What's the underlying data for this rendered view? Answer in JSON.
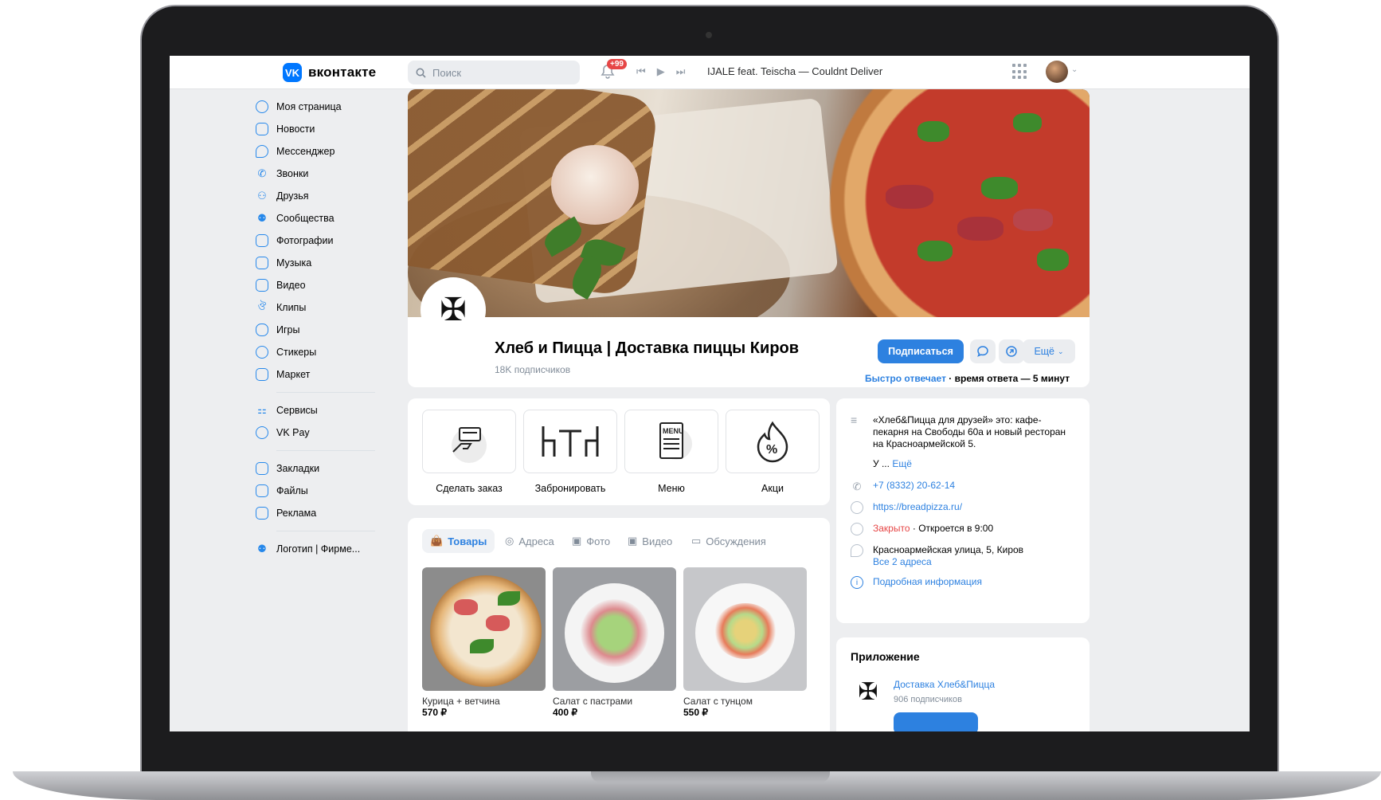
{
  "header": {
    "logo_text": "вконтакте",
    "logo_mark": "vk",
    "search_placeholder": "Поиск",
    "notifications_badge": "+99",
    "track": "IJALE feat. Teischa — Couldnt Deliver"
  },
  "sidebar": {
    "items": [
      {
        "label": "Моя страница",
        "icon": "user-circle-icon"
      },
      {
        "label": "Новости",
        "icon": "news-icon"
      },
      {
        "label": "Мессенджер",
        "icon": "message-icon"
      },
      {
        "label": "Звонки",
        "icon": "phone-icon"
      },
      {
        "label": "Друзья",
        "icon": "friends-icon"
      },
      {
        "label": "Сообщества",
        "icon": "communities-icon"
      },
      {
        "label": "Фотографии",
        "icon": "photo-icon"
      },
      {
        "label": "Музыка",
        "icon": "music-icon"
      },
      {
        "label": "Видео",
        "icon": "video-icon"
      },
      {
        "label": "Клипы",
        "icon": "clips-icon"
      },
      {
        "label": "Игры",
        "icon": "gamepad-icon"
      },
      {
        "label": "Стикеры",
        "icon": "smile-icon"
      },
      {
        "label": "Маркет",
        "icon": "bag-icon"
      }
    ],
    "items2": [
      {
        "label": "Сервисы",
        "icon": "services-icon"
      },
      {
        "label": "VK Pay",
        "icon": "vkpay-icon"
      }
    ],
    "items3": [
      {
        "label": "Закладки",
        "icon": "bookmark-icon"
      },
      {
        "label": "Файлы",
        "icon": "file-icon"
      },
      {
        "label": "Реклама",
        "icon": "megaphone-icon"
      }
    ],
    "items4": [
      {
        "label": "Логотип | Фирме...",
        "icon": "communities-icon"
      }
    ]
  },
  "group": {
    "title": "Хлеб и Пицца | Доставка пиццы Киров",
    "subscribers_count": "18K",
    "subscribers_label": "подписчиков",
    "subscribe_button": "Подписаться",
    "more_button": "Ещё",
    "reply_fast": "Быстро отвечает",
    "reply_time": "· время ответа — 5 минут"
  },
  "actions": [
    {
      "label": "Сделать заказ",
      "icon": "order-icon"
    },
    {
      "label": "Забронировать",
      "icon": "table-booking-icon"
    },
    {
      "label": "Меню",
      "icon": "menu-icon"
    },
    {
      "label": "Акци",
      "icon": "discount-icon"
    }
  ],
  "tabs": [
    {
      "label": "Товары",
      "icon": "bag-icon"
    },
    {
      "label": "Адреса",
      "icon": "pin-icon"
    },
    {
      "label": "Фото",
      "icon": "photo-icon"
    },
    {
      "label": "Видео",
      "icon": "video-icon"
    },
    {
      "label": "Обсуждения",
      "icon": "message-icon"
    }
  ],
  "products": [
    {
      "name": "Курица + ветчина",
      "price": "570 ₽"
    },
    {
      "name": "Салат с пастрами",
      "price": "400 ₽"
    },
    {
      "name": "Салат с тунцом",
      "price": "550 ₽"
    }
  ],
  "info": {
    "description": "«Хлеб&Пицца для друзей» это: кафе-пекарня на Свободы 60а и новый ресторан на Красноармейской 5.",
    "description_cont": "У ...",
    "description_more": "Ещё",
    "phone": "+7 (8332) 20-62-14",
    "site": "https://breadpizza.ru/",
    "status_closed": "Закрыто",
    "status_opens": "· Откроется в 9:00",
    "address": "Красноармейская улица, 5, Киров",
    "all_addresses": "Все 2 адреса",
    "details": "Подробная информация"
  },
  "app": {
    "section_title": "Приложение",
    "name": "Доставка Хлеб&Пицца",
    "subscribers": "906 подписчиков"
  },
  "colors": {
    "accent": "#2d81e0",
    "brand": "#0077ff",
    "closed": "#e64646",
    "background": "#edeef0"
  }
}
